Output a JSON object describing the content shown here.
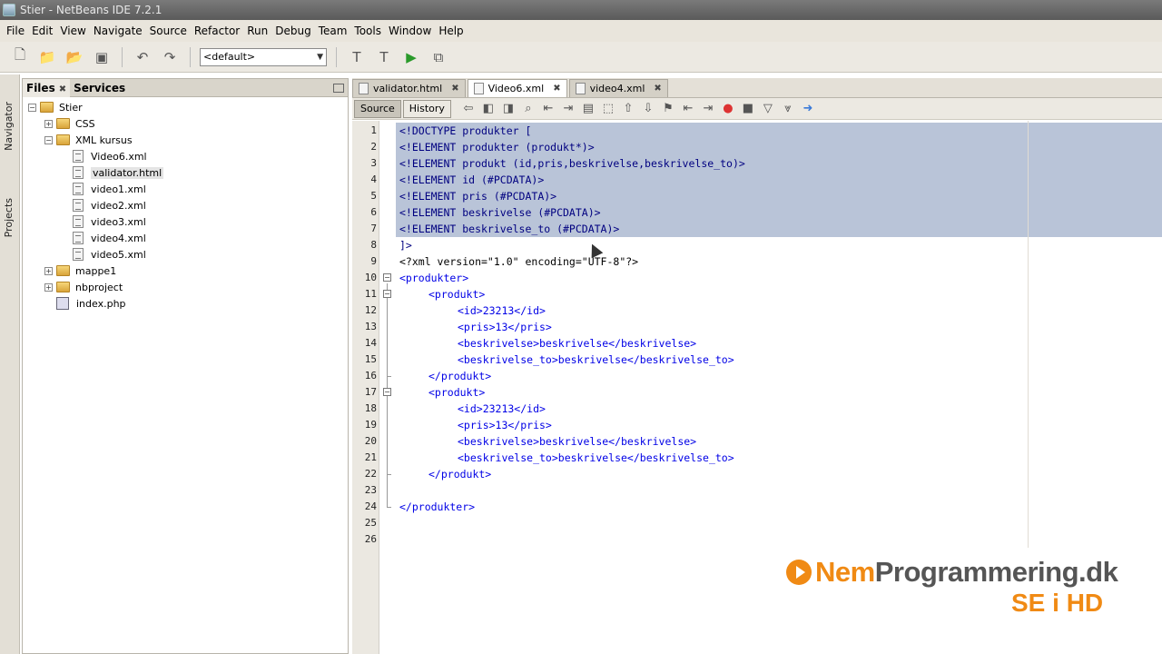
{
  "window": {
    "title": "Stier - NetBeans IDE 7.2.1"
  },
  "menu": [
    "File",
    "Edit",
    "View",
    "Navigate",
    "Source",
    "Refactor",
    "Run",
    "Debug",
    "Team",
    "Tools",
    "Window",
    "Help"
  ],
  "toolbar": {
    "config_value": "<default>"
  },
  "side_tabs": {
    "navigator": "Navigator",
    "projects": "Projects"
  },
  "files_panel": {
    "tabs": [
      "Files",
      "Services"
    ],
    "tree": [
      {
        "label": "Stier",
        "type": "folder",
        "level": 0,
        "expander": "-"
      },
      {
        "label": "CSS",
        "type": "folder",
        "level": 1,
        "expander": "+"
      },
      {
        "label": "XML kursus",
        "type": "folder",
        "level": 1,
        "expander": "-"
      },
      {
        "label": "Video6.xml",
        "type": "file",
        "level": 2
      },
      {
        "label": "validator.html",
        "type": "file",
        "level": 2,
        "selected": true
      },
      {
        "label": "video1.xml",
        "type": "file",
        "level": 2
      },
      {
        "label": "video2.xml",
        "type": "file",
        "level": 2
      },
      {
        "label": "video3.xml",
        "type": "file",
        "level": 2
      },
      {
        "label": "video4.xml",
        "type": "file",
        "level": 2
      },
      {
        "label": "video5.xml",
        "type": "file",
        "level": 2
      },
      {
        "label": "mappe1",
        "type": "folder",
        "level": 1,
        "expander": "+"
      },
      {
        "label": "nbproject",
        "type": "folder",
        "level": 1,
        "expander": "+"
      },
      {
        "label": "index.php",
        "type": "php",
        "level": 1
      }
    ]
  },
  "editor": {
    "tabs": [
      {
        "label": "validator.html",
        "active": false
      },
      {
        "label": "Video6.xml",
        "active": true
      },
      {
        "label": "video4.xml",
        "active": false
      }
    ],
    "views": [
      "Source",
      "History"
    ],
    "lines": [
      {
        "n": "1",
        "text": "<!DOCTYPE produkter [",
        "cls": "dtd",
        "sel": true,
        "indent": 0
      },
      {
        "n": "2",
        "text": "<!ELEMENT produkter (produkt*)>",
        "cls": "dtd",
        "sel": true,
        "indent": 0
      },
      {
        "n": "3",
        "text": "<!ELEMENT produkt (id,pris,beskrivelse,beskrivelse_to)>",
        "cls": "dtd",
        "sel": true,
        "indent": 0
      },
      {
        "n": "4",
        "text": "<!ELEMENT id (#PCDATA)>",
        "cls": "dtd",
        "sel": true,
        "indent": 0
      },
      {
        "n": "5",
        "text": "<!ELEMENT pris (#PCDATA)>",
        "cls": "dtd",
        "sel": true,
        "indent": 0
      },
      {
        "n": "6",
        "text": "<!ELEMENT beskrivelse (#PCDATA)>",
        "cls": "dtd",
        "sel": true,
        "indent": 0
      },
      {
        "n": "7",
        "text": "<!ELEMENT beskrivelse_to (#PCDATA)>",
        "cls": "dtd",
        "sel": true,
        "indent": 0
      },
      {
        "n": "8",
        "text": "]>",
        "cls": "dtd",
        "sel": false,
        "indent": 0
      },
      {
        "n": "9",
        "text": "<?xml version=\"1.0\" encoding=\"UTF-8\"?>",
        "cls": "pi",
        "sel": false,
        "indent": 0
      },
      {
        "n": "10",
        "text": "<produkter>",
        "cls": "tag",
        "sel": false,
        "indent": 0
      },
      {
        "n": "11",
        "text": "<produkt>",
        "cls": "tag",
        "sel": false,
        "indent": 1
      },
      {
        "n": "12",
        "text": "<id>23213</id>",
        "cls": "tag",
        "sel": false,
        "indent": 2
      },
      {
        "n": "13",
        "text": "<pris>13</pris>",
        "cls": "tag",
        "sel": false,
        "indent": 2
      },
      {
        "n": "14",
        "text": "<beskrivelse>beskrivelse</beskrivelse>",
        "cls": "tag",
        "sel": false,
        "indent": 2
      },
      {
        "n": "15",
        "text": "<beskrivelse_to>beskrivelse</beskrivelse_to>",
        "cls": "tag",
        "sel": false,
        "indent": 2
      },
      {
        "n": "16",
        "text": "</produkt>",
        "cls": "tag",
        "sel": false,
        "indent": 1
      },
      {
        "n": "17",
        "text": "<produkt>",
        "cls": "tag",
        "sel": false,
        "indent": 1
      },
      {
        "n": "18",
        "text": "<id>23213</id>",
        "cls": "tag",
        "sel": false,
        "indent": 2
      },
      {
        "n": "19",
        "text": "<pris>13</pris>",
        "cls": "tag",
        "sel": false,
        "indent": 2
      },
      {
        "n": "20",
        "text": "<beskrivelse>beskrivelse</beskrivelse>",
        "cls": "tag",
        "sel": false,
        "indent": 2
      },
      {
        "n": "21",
        "text": "<beskrivelse_to>beskrivelse</beskrivelse_to>",
        "cls": "tag",
        "sel": false,
        "indent": 2
      },
      {
        "n": "22",
        "text": "</produkt>",
        "cls": "tag",
        "sel": false,
        "indent": 1
      },
      {
        "n": "23",
        "text": "",
        "cls": "tag",
        "sel": false,
        "indent": 0
      },
      {
        "n": "24",
        "text": "</produkter>",
        "cls": "tag",
        "sel": false,
        "indent": 0
      },
      {
        "n": "25",
        "text": "",
        "cls": "tag",
        "sel": false,
        "indent": 0
      },
      {
        "n": "26",
        "text": "",
        "cls": "tag",
        "sel": false,
        "indent": 0
      }
    ]
  },
  "watermark": {
    "brand_a": "Nem",
    "brand_b": "Programmering.dk",
    "sub": "SE i HD"
  },
  "colors": {
    "selection": "#b9c4d8",
    "tag": "#0000e6",
    "brand_orange": "#f08a14"
  }
}
